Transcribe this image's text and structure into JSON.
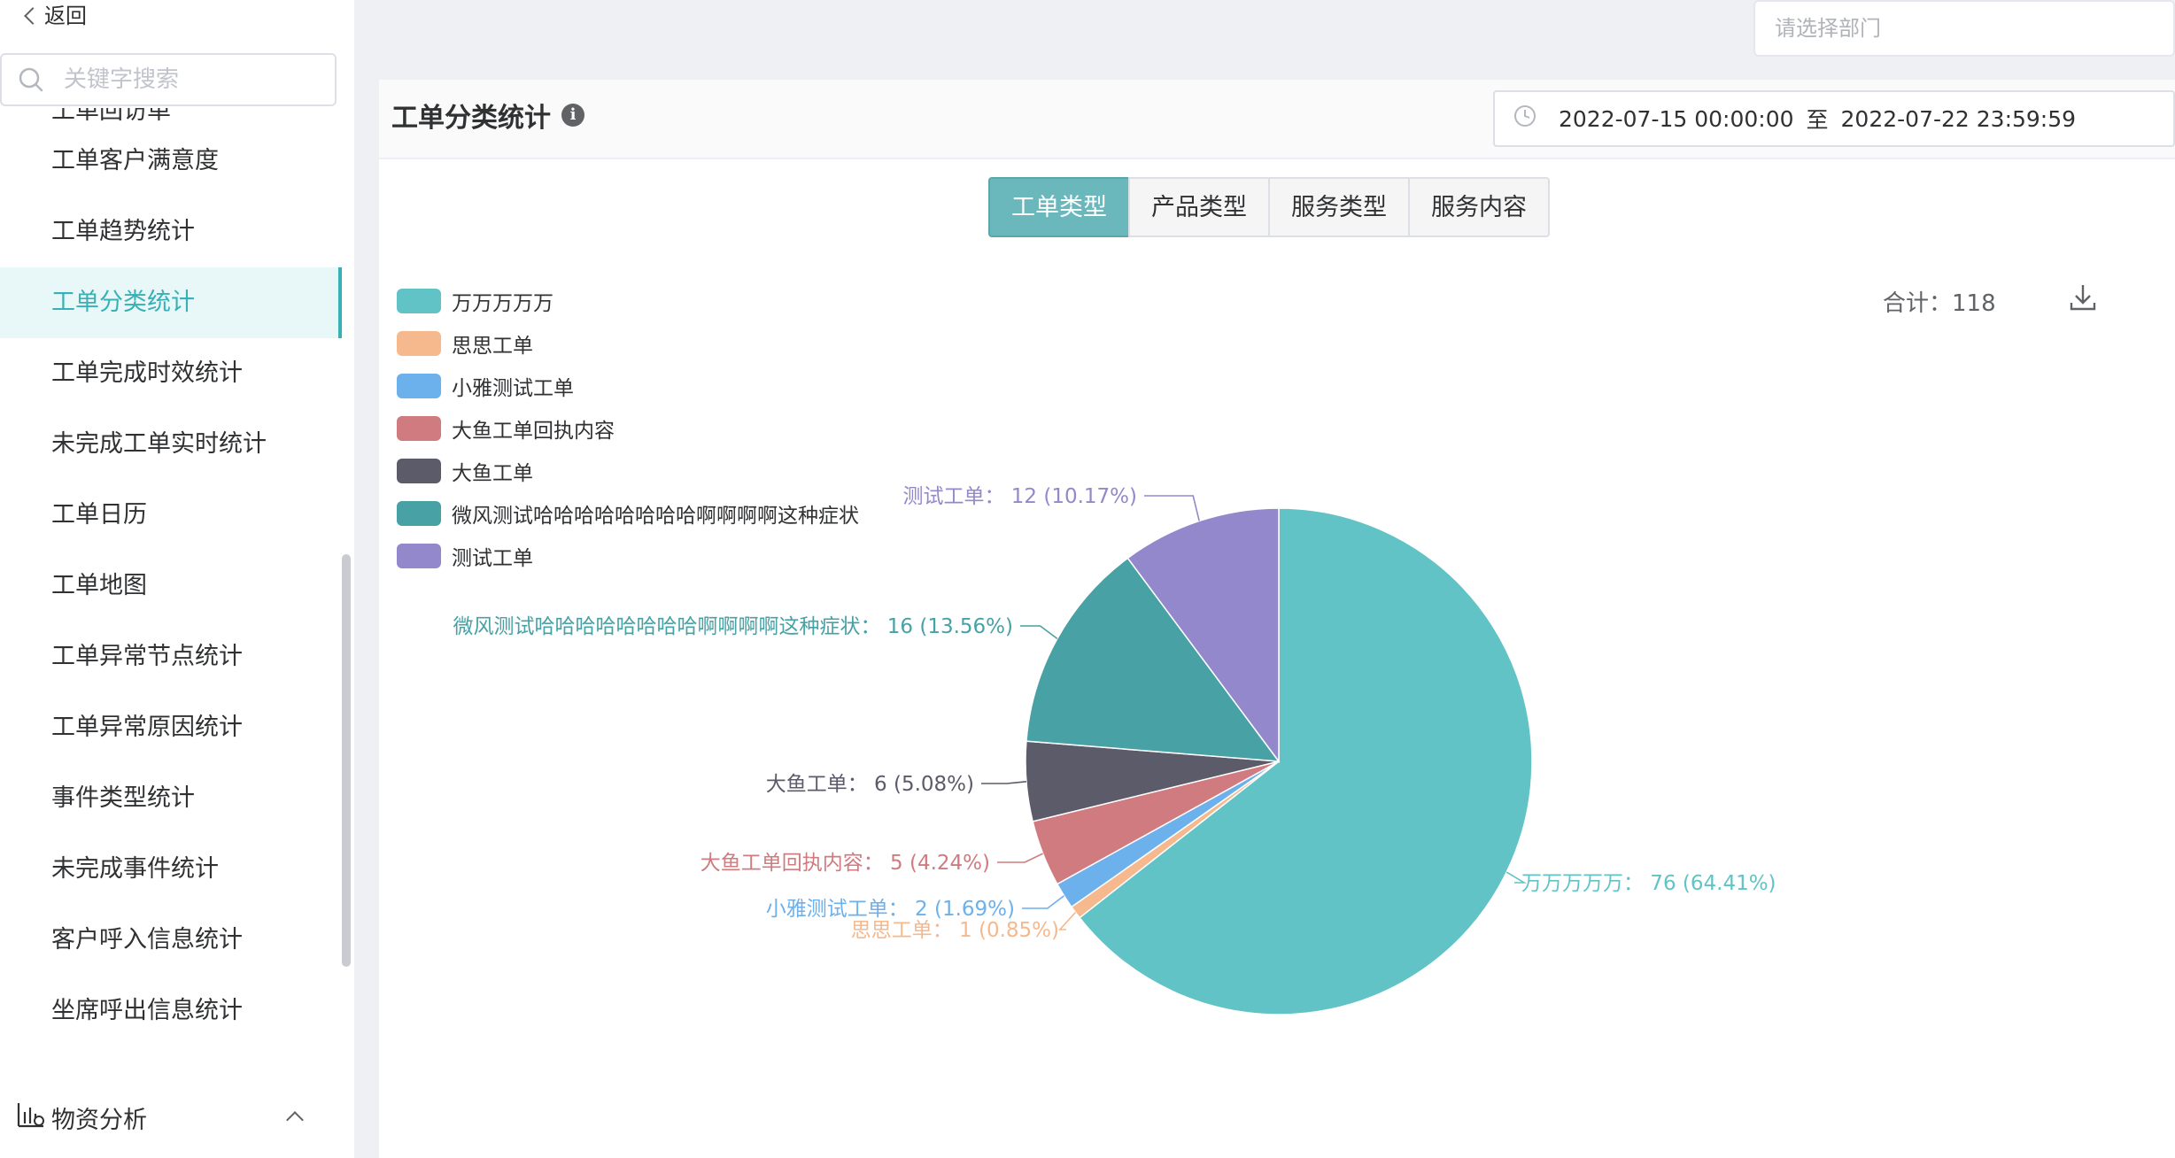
{
  "sidebar": {
    "back_label": "返回",
    "search_placeholder": "关键字搜索",
    "cut_item": "工单回访单",
    "items": [
      {
        "label": "工单客户满意度",
        "active": false
      },
      {
        "label": "工单趋势统计",
        "active": false
      },
      {
        "label": "工单分类统计",
        "active": true
      },
      {
        "label": "工单完成时效统计",
        "active": false
      },
      {
        "label": "未完成工单实时统计",
        "active": false
      },
      {
        "label": "工单日历",
        "active": false
      },
      {
        "label": "工单地图",
        "active": false
      },
      {
        "label": "工单异常节点统计",
        "active": false
      },
      {
        "label": "工单异常原因统计",
        "active": false
      },
      {
        "label": "事件类型统计",
        "active": false
      },
      {
        "label": "未完成事件统计",
        "active": false
      },
      {
        "label": "客户呼入信息统计",
        "active": false
      },
      {
        "label": "坐席呼出信息统计",
        "active": false
      }
    ],
    "group": {
      "label": "物资分析"
    }
  },
  "dept_select": {
    "placeholder": "请选择部门"
  },
  "panel": {
    "title": "工单分类统计",
    "date_start": "2022-07-15 00:00:00",
    "date_sep": "至",
    "date_end": "2022-07-22 23:59:59",
    "tabs": [
      "工单类型",
      "产品类型",
      "服务类型",
      "服务内容"
    ],
    "active_tab": 0,
    "total_label": "合计：118"
  },
  "chart_data": {
    "type": "pie",
    "total": 118,
    "slices": [
      {
        "name": "万万万万万",
        "value": 76,
        "percent": "64.41%",
        "color": "#62c3c6"
      },
      {
        "name": "思思工单",
        "value": 1,
        "percent": "0.85%",
        "color": "#f6b88d"
      },
      {
        "name": "小雅测试工单",
        "value": 2,
        "percent": "1.69%",
        "color": "#6cb0ec"
      },
      {
        "name": "大鱼工单回执内容",
        "value": 5,
        "percent": "4.24%",
        "color": "#d07b7f"
      },
      {
        "name": "大鱼工单",
        "value": 6,
        "percent": "5.08%",
        "color": "#5c5b6a"
      },
      {
        "name": "微风测试哈哈哈哈哈哈哈哈啊啊啊啊这种症状",
        "value": 16,
        "percent": "13.56%",
        "color": "#48a1a4"
      },
      {
        "name": "测试工单",
        "value": 12,
        "percent": "10.17%",
        "color": "#9488cd"
      }
    ]
  }
}
